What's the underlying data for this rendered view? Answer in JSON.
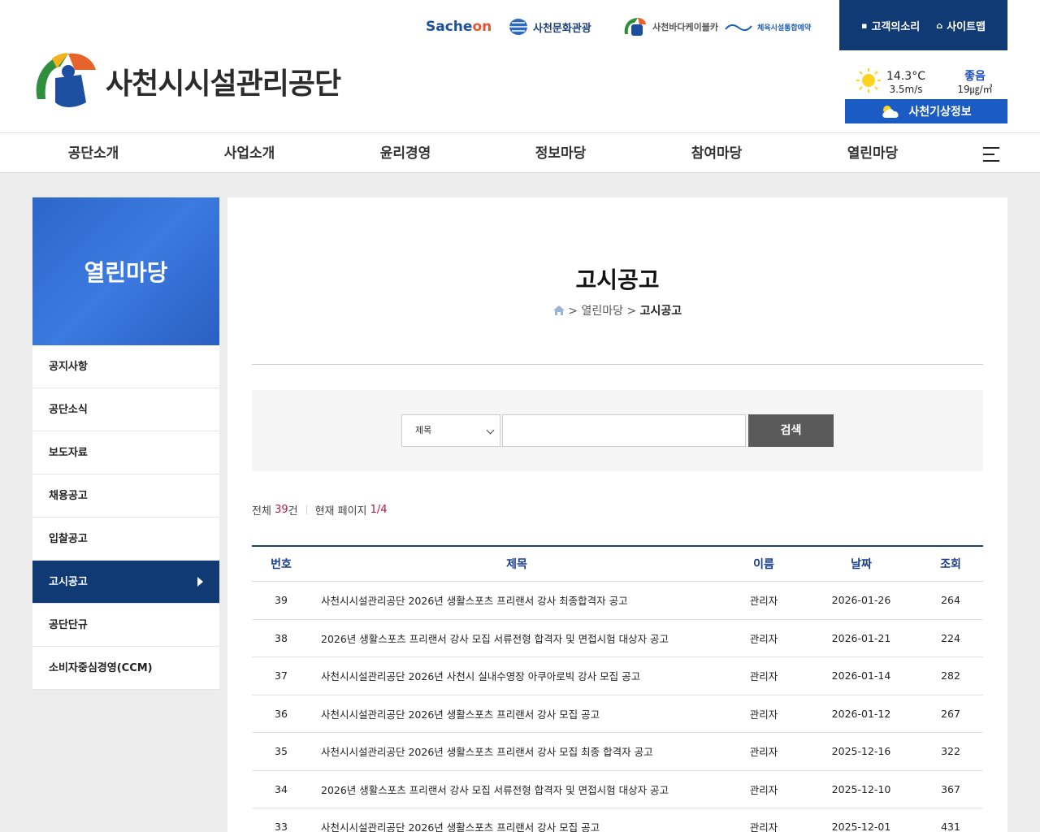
{
  "header": {
    "logo_text": "사천시시설관리공단",
    "partners": {
      "sacheon_pre": "Sache",
      "sacheon_on": "on",
      "culture": "사천문화관광",
      "cable": "사천바다케이블카",
      "sports": "체육시설통합예약"
    },
    "top_buttons": {
      "voice": "고객의소리",
      "sitemap": "사이트맵"
    },
    "weather": {
      "temperature": "14.3°C",
      "wind": "3.5m/s",
      "air_quality": "좋음",
      "pm": "19㎍/㎥",
      "button_label": "사천기상정보"
    }
  },
  "nav": {
    "items": [
      "공단소개",
      "사업소개",
      "윤리경영",
      "정보마당",
      "참여마당",
      "열린마당"
    ]
  },
  "sidebar": {
    "title": "열린마당",
    "items": [
      "공지사항",
      "공단소식",
      "보도자료",
      "채용공고",
      "입찰공고",
      "고시공고",
      "공단단규",
      "소비자중심경영(CCM)"
    ],
    "active_index": 5
  },
  "page": {
    "title": "고시공고",
    "breadcrumb": {
      "sep": ">",
      "parent": "열린마당",
      "current": "고시공고"
    }
  },
  "search": {
    "select_value": "제목",
    "button": "검색"
  },
  "count": {
    "total_label": "전체",
    "total": "39",
    "total_unit": "건",
    "page_label": "현재 페이지",
    "page": "1/4"
  },
  "table": {
    "headers": {
      "no": "번호",
      "title": "제목",
      "name": "이름",
      "date": "날짜",
      "views": "조회"
    },
    "rows": [
      {
        "no": "39",
        "title": "사천시시설관리공단 2026년 생활스포츠 프리랜서 강사 최종합격자 공고",
        "name": "관리자",
        "date": "2026-01-26",
        "views": "264"
      },
      {
        "no": "38",
        "title": "2026년 생활스포츠 프리랜서 강사 모집 서류전형 합격자 및 면접시험 대상자 공고",
        "name": "관리자",
        "date": "2026-01-21",
        "views": "224"
      },
      {
        "no": "37",
        "title": "사천시시설관리공단 2026년 사천시 실내수영장 아쿠아로빅 강사 모집 공고",
        "name": "관리자",
        "date": "2026-01-14",
        "views": "282"
      },
      {
        "no": "36",
        "title": "사천시시설관리공단 2026년 생활스포츠 프리랜서 강사 모집 공고",
        "name": "관리자",
        "date": "2026-01-12",
        "views": "267"
      },
      {
        "no": "35",
        "title": "사천시시설관리공단 2026년 생활스포츠 프리랜서 강사 모집 최종 합격자 공고",
        "name": "관리자",
        "date": "2025-12-16",
        "views": "322"
      },
      {
        "no": "34",
        "title": "2026년 생활스포츠 프리랜서 강사 모집 서류전형 합격자 및 면접시험 대상자 공고",
        "name": "관리자",
        "date": "2025-12-10",
        "views": "367"
      },
      {
        "no": "33",
        "title": "사천시시설관리공단 2026년 생활스포츠 프리랜서 강사 모집 공고",
        "name": "관리자",
        "date": "2025-12-01",
        "views": "431"
      }
    ]
  },
  "colors": {
    "navy": "#0f3a73",
    "blue": "#1a5bc4",
    "accent_red": "#c0143c"
  }
}
